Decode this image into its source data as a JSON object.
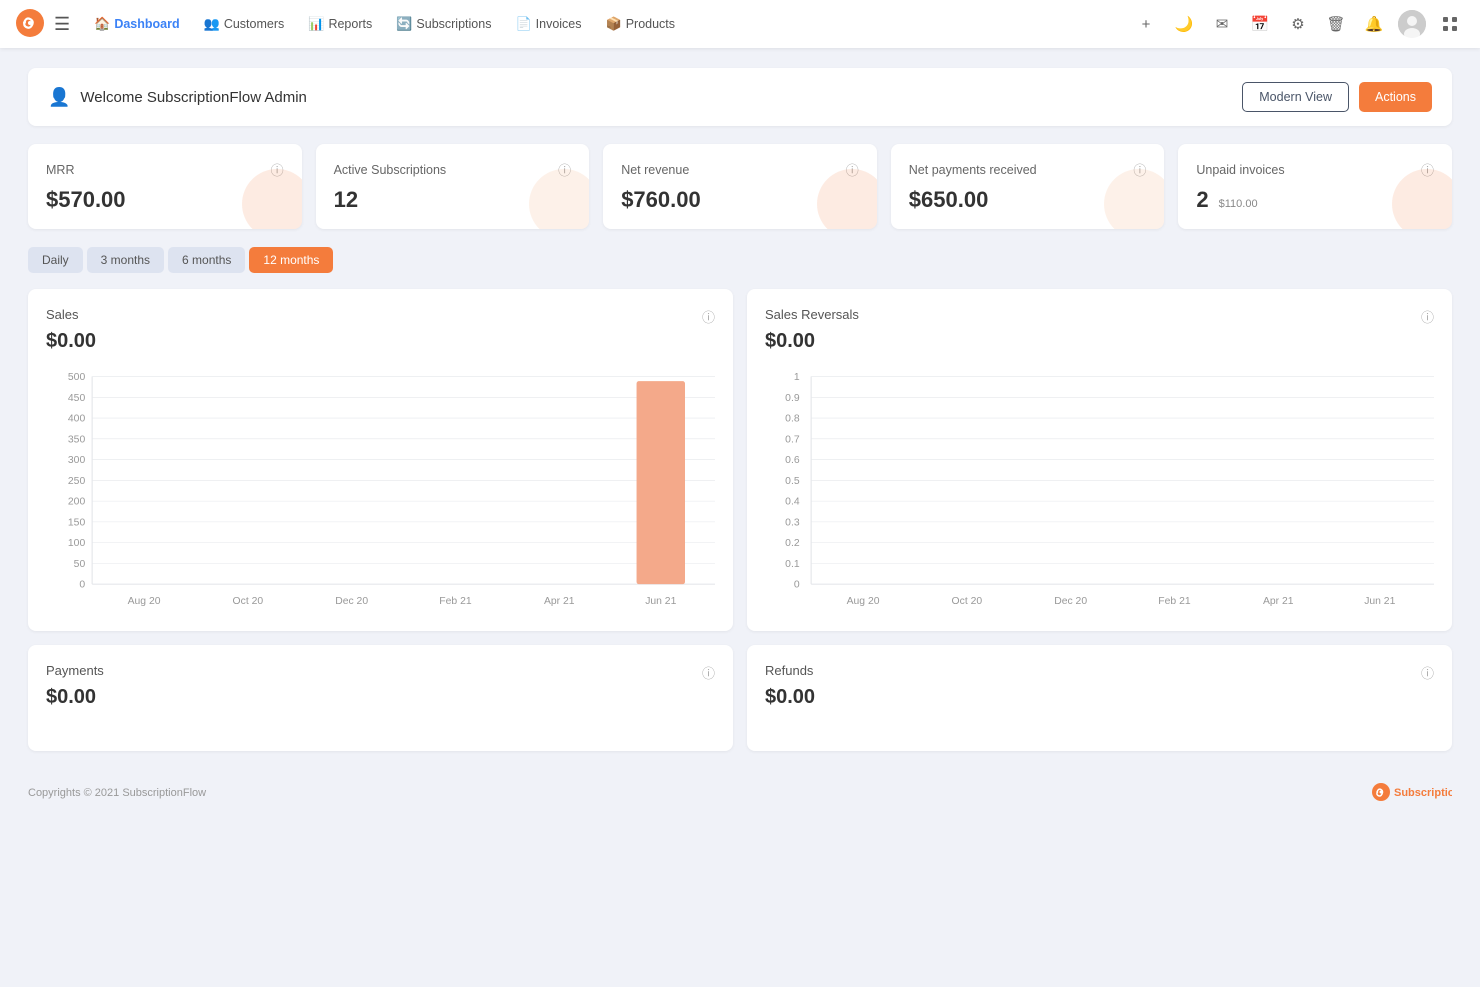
{
  "app": {
    "logo_text": "S",
    "title": "SubscriptionFlow"
  },
  "nav": {
    "links": [
      {
        "label": "Dashboard",
        "icon": "🏠",
        "active": true
      },
      {
        "label": "Customers",
        "icon": "👥",
        "active": false
      },
      {
        "label": "Reports",
        "icon": "📊",
        "active": false
      },
      {
        "label": "Subscriptions",
        "icon": "🔄",
        "active": false
      },
      {
        "label": "Invoices",
        "icon": "📄",
        "active": false
      },
      {
        "label": "Products",
        "icon": "📦",
        "active": false
      }
    ],
    "actions": {
      "plus": "+",
      "moon": "🌙",
      "email": "✉",
      "calendar": "📅",
      "settings": "⚙",
      "trash": "🗑",
      "bell": "🔔",
      "grid": "⋮⋮"
    }
  },
  "welcome": {
    "title": "Welcome SubscriptionFlow Admin",
    "modern_view_label": "Modern View",
    "actions_label": "Actions"
  },
  "stats": [
    {
      "title": "MRR",
      "value": "$570.00",
      "sub": ""
    },
    {
      "title": "Active Subscriptions",
      "value": "12",
      "sub": ""
    },
    {
      "title": "Net revenue",
      "value": "$760.00",
      "sub": ""
    },
    {
      "title": "Net payments received",
      "value": "$650.00",
      "sub": ""
    },
    {
      "title": "Unpaid invoices",
      "value": "2",
      "sub": "$110.00"
    }
  ],
  "filters": [
    {
      "label": "Daily",
      "active": false
    },
    {
      "label": "3 months",
      "active": false
    },
    {
      "label": "6 months",
      "active": false
    },
    {
      "label": "12 months",
      "active": true
    }
  ],
  "charts": [
    {
      "title": "Sales",
      "value": "$0.00",
      "x_labels": [
        "Aug 20",
        "Oct 20",
        "Dec 20",
        "Feb 21",
        "Apr 21",
        "Jun 21"
      ],
      "y_labels": [
        "500",
        "450",
        "400",
        "350",
        "300",
        "250",
        "200",
        "150",
        "100",
        "50",
        "0"
      ],
      "bar_data": [
        0,
        0,
        0,
        0,
        0,
        480
      ],
      "bar_color": "#f4a98a"
    },
    {
      "title": "Sales Reversals",
      "value": "$0.00",
      "x_labels": [
        "Aug 20",
        "Oct 20",
        "Dec 20",
        "Feb 21",
        "Apr 21",
        "Jun 21"
      ],
      "y_labels": [
        "1",
        "0.9",
        "0.8",
        "0.7",
        "0.6",
        "0.5",
        "0.4",
        "0.3",
        "0.2",
        "0.1",
        "0"
      ],
      "bar_data": [
        0,
        0,
        0,
        0,
        0,
        0
      ],
      "bar_color": "#f4a98a"
    }
  ],
  "charts2": [
    {
      "title": "Payments",
      "value": "$0.00"
    },
    {
      "title": "Refunds",
      "value": "$0.00"
    }
  ],
  "footer": {
    "copyright": "Copyrights © 2021 SubscriptionFlow",
    "brand": "SubscriptionFlow"
  }
}
